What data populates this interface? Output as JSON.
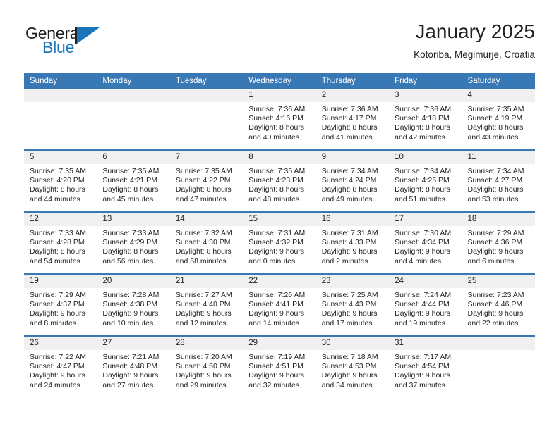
{
  "brand": {
    "name_part1": "General",
    "name_part2": "Blue",
    "logo_icon": "blue-triangle-logo",
    "accent_color": "#1b75bb"
  },
  "header": {
    "title": "January 2025",
    "subtitle": "Kotoriba, Megimurje, Croatia"
  },
  "calendar": {
    "header_bg": "#3878b4",
    "daynum_bg": "#f0f0f0",
    "weekdays": [
      "Sunday",
      "Monday",
      "Tuesday",
      "Wednesday",
      "Thursday",
      "Friday",
      "Saturday"
    ],
    "weeks": [
      [
        {
          "day": "",
          "empty": true,
          "sunrise": "",
          "sunset": "",
          "daylight1": "",
          "daylight2": ""
        },
        {
          "day": "",
          "empty": true,
          "sunrise": "",
          "sunset": "",
          "daylight1": "",
          "daylight2": ""
        },
        {
          "day": "",
          "empty": true,
          "sunrise": "",
          "sunset": "",
          "daylight1": "",
          "daylight2": ""
        },
        {
          "day": "1",
          "empty": false,
          "sunrise": "Sunrise: 7:36 AM",
          "sunset": "Sunset: 4:16 PM",
          "daylight1": "Daylight: 8 hours",
          "daylight2": "and 40 minutes."
        },
        {
          "day": "2",
          "empty": false,
          "sunrise": "Sunrise: 7:36 AM",
          "sunset": "Sunset: 4:17 PM",
          "daylight1": "Daylight: 8 hours",
          "daylight2": "and 41 minutes."
        },
        {
          "day": "3",
          "empty": false,
          "sunrise": "Sunrise: 7:36 AM",
          "sunset": "Sunset: 4:18 PM",
          "daylight1": "Daylight: 8 hours",
          "daylight2": "and 42 minutes."
        },
        {
          "day": "4",
          "empty": false,
          "sunrise": "Sunrise: 7:35 AM",
          "sunset": "Sunset: 4:19 PM",
          "daylight1": "Daylight: 8 hours",
          "daylight2": "and 43 minutes."
        }
      ],
      [
        {
          "day": "5",
          "empty": false,
          "sunrise": "Sunrise: 7:35 AM",
          "sunset": "Sunset: 4:20 PM",
          "daylight1": "Daylight: 8 hours",
          "daylight2": "and 44 minutes."
        },
        {
          "day": "6",
          "empty": false,
          "sunrise": "Sunrise: 7:35 AM",
          "sunset": "Sunset: 4:21 PM",
          "daylight1": "Daylight: 8 hours",
          "daylight2": "and 45 minutes."
        },
        {
          "day": "7",
          "empty": false,
          "sunrise": "Sunrise: 7:35 AM",
          "sunset": "Sunset: 4:22 PM",
          "daylight1": "Daylight: 8 hours",
          "daylight2": "and 47 minutes."
        },
        {
          "day": "8",
          "empty": false,
          "sunrise": "Sunrise: 7:35 AM",
          "sunset": "Sunset: 4:23 PM",
          "daylight1": "Daylight: 8 hours",
          "daylight2": "and 48 minutes."
        },
        {
          "day": "9",
          "empty": false,
          "sunrise": "Sunrise: 7:34 AM",
          "sunset": "Sunset: 4:24 PM",
          "daylight1": "Daylight: 8 hours",
          "daylight2": "and 49 minutes."
        },
        {
          "day": "10",
          "empty": false,
          "sunrise": "Sunrise: 7:34 AM",
          "sunset": "Sunset: 4:25 PM",
          "daylight1": "Daylight: 8 hours",
          "daylight2": "and 51 minutes."
        },
        {
          "day": "11",
          "empty": false,
          "sunrise": "Sunrise: 7:34 AM",
          "sunset": "Sunset: 4:27 PM",
          "daylight1": "Daylight: 8 hours",
          "daylight2": "and 53 minutes."
        }
      ],
      [
        {
          "day": "12",
          "empty": false,
          "sunrise": "Sunrise: 7:33 AM",
          "sunset": "Sunset: 4:28 PM",
          "daylight1": "Daylight: 8 hours",
          "daylight2": "and 54 minutes."
        },
        {
          "day": "13",
          "empty": false,
          "sunrise": "Sunrise: 7:33 AM",
          "sunset": "Sunset: 4:29 PM",
          "daylight1": "Daylight: 8 hours",
          "daylight2": "and 56 minutes."
        },
        {
          "day": "14",
          "empty": false,
          "sunrise": "Sunrise: 7:32 AM",
          "sunset": "Sunset: 4:30 PM",
          "daylight1": "Daylight: 8 hours",
          "daylight2": "and 58 minutes."
        },
        {
          "day": "15",
          "empty": false,
          "sunrise": "Sunrise: 7:31 AM",
          "sunset": "Sunset: 4:32 PM",
          "daylight1": "Daylight: 9 hours",
          "daylight2": "and 0 minutes."
        },
        {
          "day": "16",
          "empty": false,
          "sunrise": "Sunrise: 7:31 AM",
          "sunset": "Sunset: 4:33 PM",
          "daylight1": "Daylight: 9 hours",
          "daylight2": "and 2 minutes."
        },
        {
          "day": "17",
          "empty": false,
          "sunrise": "Sunrise: 7:30 AM",
          "sunset": "Sunset: 4:34 PM",
          "daylight1": "Daylight: 9 hours",
          "daylight2": "and 4 minutes."
        },
        {
          "day": "18",
          "empty": false,
          "sunrise": "Sunrise: 7:29 AM",
          "sunset": "Sunset: 4:36 PM",
          "daylight1": "Daylight: 9 hours",
          "daylight2": "and 6 minutes."
        }
      ],
      [
        {
          "day": "19",
          "empty": false,
          "sunrise": "Sunrise: 7:29 AM",
          "sunset": "Sunset: 4:37 PM",
          "daylight1": "Daylight: 9 hours",
          "daylight2": "and 8 minutes."
        },
        {
          "day": "20",
          "empty": false,
          "sunrise": "Sunrise: 7:28 AM",
          "sunset": "Sunset: 4:38 PM",
          "daylight1": "Daylight: 9 hours",
          "daylight2": "and 10 minutes."
        },
        {
          "day": "21",
          "empty": false,
          "sunrise": "Sunrise: 7:27 AM",
          "sunset": "Sunset: 4:40 PM",
          "daylight1": "Daylight: 9 hours",
          "daylight2": "and 12 minutes."
        },
        {
          "day": "22",
          "empty": false,
          "sunrise": "Sunrise: 7:26 AM",
          "sunset": "Sunset: 4:41 PM",
          "daylight1": "Daylight: 9 hours",
          "daylight2": "and 14 minutes."
        },
        {
          "day": "23",
          "empty": false,
          "sunrise": "Sunrise: 7:25 AM",
          "sunset": "Sunset: 4:43 PM",
          "daylight1": "Daylight: 9 hours",
          "daylight2": "and 17 minutes."
        },
        {
          "day": "24",
          "empty": false,
          "sunrise": "Sunrise: 7:24 AM",
          "sunset": "Sunset: 4:44 PM",
          "daylight1": "Daylight: 9 hours",
          "daylight2": "and 19 minutes."
        },
        {
          "day": "25",
          "empty": false,
          "sunrise": "Sunrise: 7:23 AM",
          "sunset": "Sunset: 4:46 PM",
          "daylight1": "Daylight: 9 hours",
          "daylight2": "and 22 minutes."
        }
      ],
      [
        {
          "day": "26",
          "empty": false,
          "sunrise": "Sunrise: 7:22 AM",
          "sunset": "Sunset: 4:47 PM",
          "daylight1": "Daylight: 9 hours",
          "daylight2": "and 24 minutes."
        },
        {
          "day": "27",
          "empty": false,
          "sunrise": "Sunrise: 7:21 AM",
          "sunset": "Sunset: 4:48 PM",
          "daylight1": "Daylight: 9 hours",
          "daylight2": "and 27 minutes."
        },
        {
          "day": "28",
          "empty": false,
          "sunrise": "Sunrise: 7:20 AM",
          "sunset": "Sunset: 4:50 PM",
          "daylight1": "Daylight: 9 hours",
          "daylight2": "and 29 minutes."
        },
        {
          "day": "29",
          "empty": false,
          "sunrise": "Sunrise: 7:19 AM",
          "sunset": "Sunset: 4:51 PM",
          "daylight1": "Daylight: 9 hours",
          "daylight2": "and 32 minutes."
        },
        {
          "day": "30",
          "empty": false,
          "sunrise": "Sunrise: 7:18 AM",
          "sunset": "Sunset: 4:53 PM",
          "daylight1": "Daylight: 9 hours",
          "daylight2": "and 34 minutes."
        },
        {
          "day": "31",
          "empty": false,
          "sunrise": "Sunrise: 7:17 AM",
          "sunset": "Sunset: 4:54 PM",
          "daylight1": "Daylight: 9 hours",
          "daylight2": "and 37 minutes."
        },
        {
          "day": "",
          "empty": true,
          "sunrise": "",
          "sunset": "",
          "daylight1": "",
          "daylight2": ""
        }
      ]
    ]
  }
}
